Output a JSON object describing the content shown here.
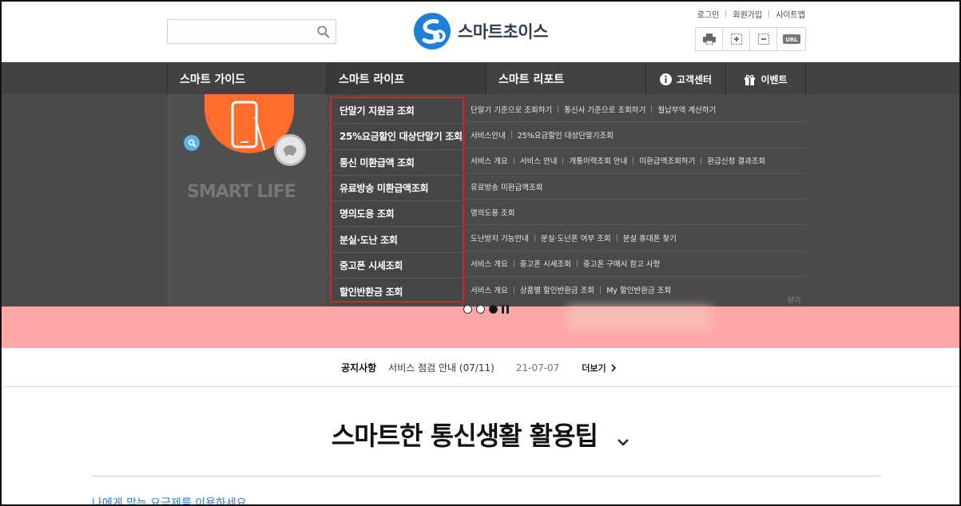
{
  "header": {
    "search_placeholder": "",
    "logo_text": "스마트초이스",
    "util_links": [
      "로그인",
      "회원가입",
      "사이트맵"
    ],
    "tools": [
      "print-icon",
      "zoom-in-icon",
      "zoom-out-icon",
      "url-icon"
    ],
    "url_label": "URL"
  },
  "nav": {
    "items": [
      "스마트 가이드",
      "스마트 라이프",
      "스마트 리포트"
    ],
    "customer_center": "고객센터",
    "event": "이벤트"
  },
  "mega": {
    "brand_text": "SMART LIFE",
    "menu": [
      "단말기 지원금 조회",
      "25%요금할인 대상단말기 조회",
      "통신 미환급액 조회",
      "유료방송 미환급액조회",
      "명의도용 조회",
      "분실·도난 조회",
      "중고폰 시세조회",
      "할인반환금 조회"
    ],
    "sub": [
      [
        "단말기 기준으로 조회하기",
        "통신사 기준으로 조회하기",
        "월납부액 계산하기"
      ],
      [
        "서비스안내",
        "25%요금할인 대상단말기조회"
      ],
      [
        "서비스 개요",
        "서비스 안내",
        "개통이력조회 안내",
        "미환급액조회하기",
        "환급신청 결과조회"
      ],
      [
        "유료방송 미환급액조회"
      ],
      [
        "명의도용 조회"
      ],
      [
        "도난방지 기능안내",
        "분실·도난폰 여부 조회",
        "분실 휴대폰 찾기"
      ],
      [
        "서비스 개요",
        "중고폰 시세조회",
        "중고폰 구매시 참고 사항"
      ],
      [
        "서비스 개요",
        "상품별 할인반환금 조회",
        "My 할인반환금 조회"
      ]
    ],
    "close_label": "닫기"
  },
  "notice": {
    "title": "공지사항",
    "text": "서비스 점검 안내 (07/11)",
    "date": "21-07-07",
    "more": "더보기"
  },
  "section": {
    "title": "스마트한 통신생활 활용팁",
    "cut_link": "나에게 맞는 요금제를 이용하세요"
  },
  "colors": {
    "nav_bg": "#424242",
    "mega_bg": "#4a4a4a",
    "highlight_border": "#d6202a",
    "banner_bg": "#ffa7a7",
    "logo_blue": "#1f7fd6"
  }
}
